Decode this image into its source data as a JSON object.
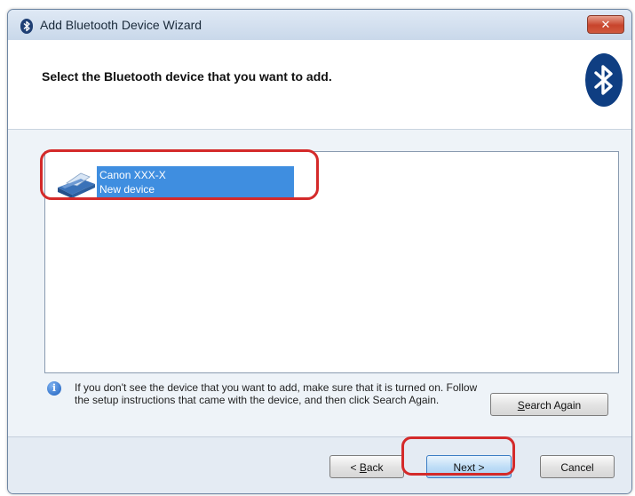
{
  "window": {
    "title": "Add Bluetooth Device Wizard",
    "title_icon": "bluetooth-icon",
    "close_symbol": "✕"
  },
  "header": {
    "instruction": "Select the Bluetooth device that you want to add.",
    "logo_icon": "bluetooth-logo"
  },
  "device_list": {
    "items": [
      {
        "name": "Canon XXX-X",
        "status": "New device",
        "icon": "printer-icon",
        "selected": true
      }
    ]
  },
  "info": {
    "icon": "info-icon",
    "text": "If you don't see the device that you want to add, make sure that it is turned on. Follow the setup instructions that came with the device, and then click Search Again."
  },
  "buttons": {
    "search_again_prefix": "",
    "search_again_accel": "S",
    "search_again_rest": "earch Again",
    "back_prefix": "< ",
    "back_accel": "B",
    "back_rest": "ack",
    "next": "Next >",
    "cancel": "Cancel"
  },
  "colors": {
    "selection": "#3f8ee0",
    "annotation": "#d42a2a",
    "bluetooth": "#0f3e82"
  }
}
